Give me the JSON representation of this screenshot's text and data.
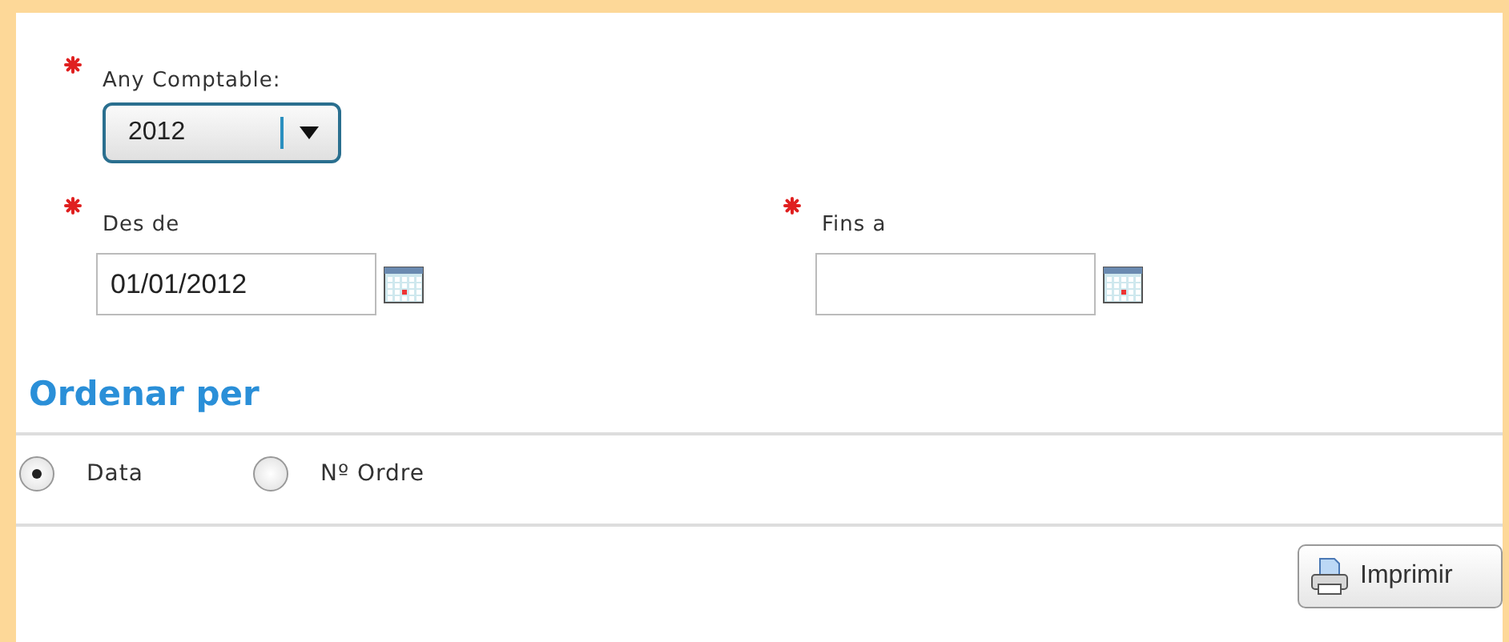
{
  "year_field": {
    "label": "Any Comptable:",
    "required": true,
    "value": "2012"
  },
  "date_fields": [
    {
      "label": "Des de",
      "required": true,
      "value": "01/01/2012"
    },
    {
      "label": "Fins a",
      "required": true
    }
  ],
  "order_section": {
    "title": "Ordenar per",
    "options": [
      {
        "label": "Data",
        "selected": true
      },
      {
        "label": "Nº Ordre",
        "selected": false
      }
    ]
  },
  "print_button": {
    "label": "Imprimir"
  }
}
